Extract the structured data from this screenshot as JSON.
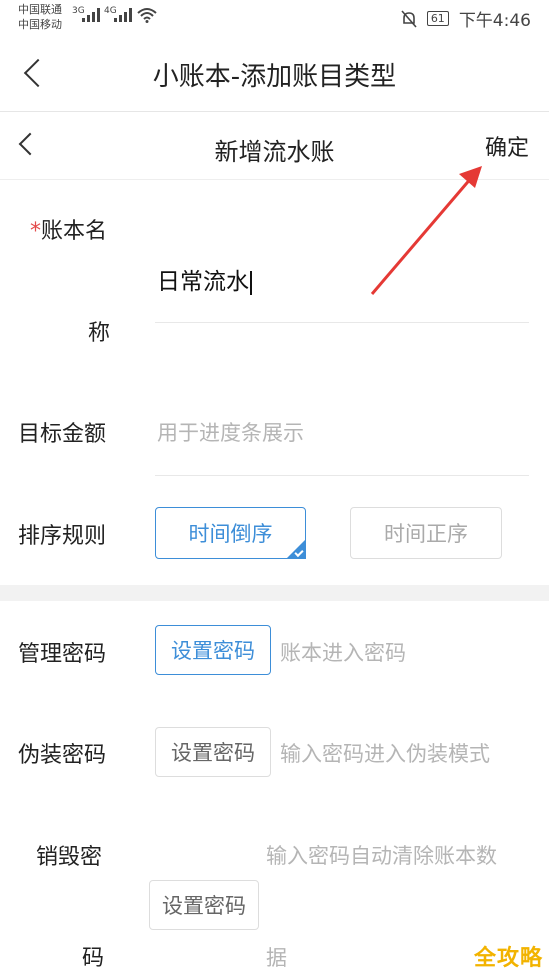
{
  "status_bar": {
    "carrier1": "中国联通",
    "carrier2": "中国移动",
    "net1": "3G",
    "net2": "4G",
    "battery": "61",
    "time": "下午4:46"
  },
  "topbar": {
    "title": "小账本-添加账目类型"
  },
  "navbar": {
    "title": "新增流水账",
    "confirm_label": "确定"
  },
  "form": {
    "name": {
      "label_required": "*",
      "label_line1": "账本名",
      "label_line2": "称",
      "value": "日常流水"
    },
    "target_amount": {
      "label": "目标金额",
      "placeholder": "用于进度条展示"
    },
    "sort_rule": {
      "label": "排序规则",
      "options": [
        "时间倒序",
        "时间正序"
      ],
      "selected": "时间倒序"
    },
    "admin_password": {
      "label": "管理密码",
      "button": "设置密码",
      "hint": "账本进入密码"
    },
    "disguise_password": {
      "label": "伪装密码",
      "button": "设置密码",
      "hint": "输入密码进入伪装模式"
    },
    "destroy_password": {
      "label_line1": "销毁密",
      "label_line2": "码",
      "button": "设置密码",
      "hint_line1": "输入密码自动清除账本数",
      "hint_line2": "据"
    }
  },
  "watermark": "全攻略",
  "colors": {
    "accent": "#3d8ed8",
    "annotation_arrow": "#e53935",
    "required_star": "#e34b4b"
  }
}
